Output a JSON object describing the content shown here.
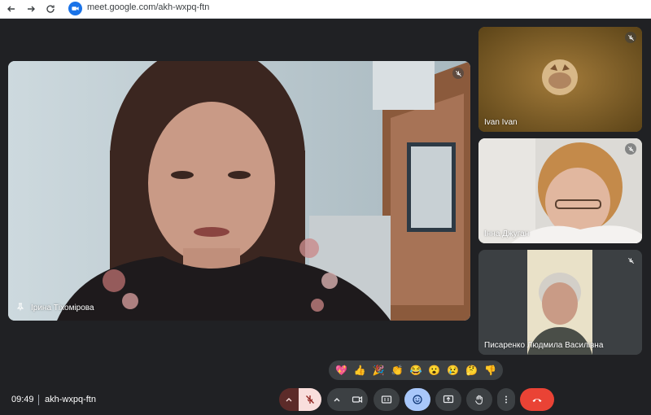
{
  "browser": {
    "url": "meet.google.com/akh-wxpq-ftn"
  },
  "tiles": {
    "main": {
      "name": "Ірина Тіхомірова"
    },
    "side": [
      {
        "name": "Ivan Ivan"
      },
      {
        "name": "Інна Джуган"
      },
      {
        "name": "Писаренко Людмила Василівна"
      }
    ]
  },
  "reactions": [
    "💖",
    "👍",
    "🎉",
    "👏",
    "😂",
    "😮",
    "😢",
    "🤔",
    "👎"
  ],
  "bottom": {
    "time": "09:49",
    "meeting_code": "akh-wxpq-ftn"
  },
  "colors": {
    "background": "#202124",
    "end_call": "#ea4335",
    "mic_muted": "#f9dedc",
    "active_blue": "#a8c7fa",
    "control": "#3c4043"
  }
}
